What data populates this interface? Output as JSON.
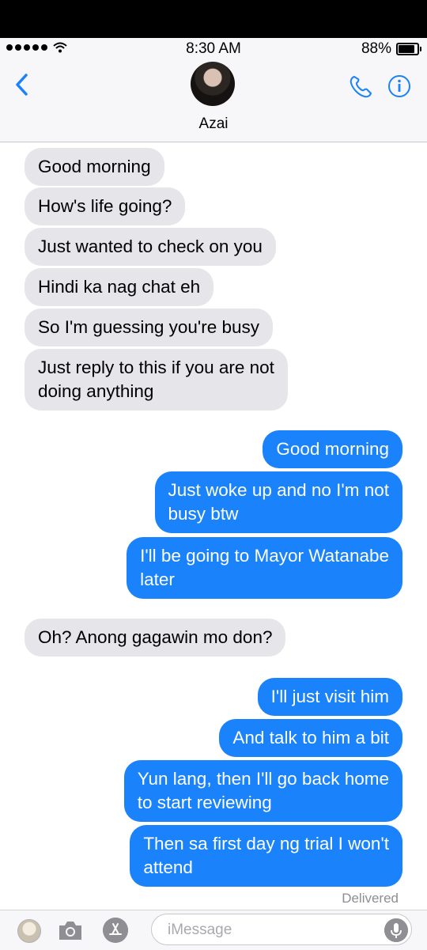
{
  "status": {
    "time": "8:30 AM",
    "battery": "88%",
    "battery_level": 0.88
  },
  "header": {
    "contact_name": "Azai"
  },
  "thread": {
    "messages": [
      {
        "from": "them",
        "text": "Good morning"
      },
      {
        "from": "them",
        "text": "How's life going?"
      },
      {
        "from": "them",
        "text": "Just wanted to check on you"
      },
      {
        "from": "them",
        "text": "Hindi ka nag chat eh"
      },
      {
        "from": "them",
        "text": "So I'm guessing you're busy"
      },
      {
        "from": "them",
        "text": "Just reply to this if you are not\ndoing anything"
      },
      {
        "from": "me",
        "text": "Good morning"
      },
      {
        "from": "me",
        "text": "Just woke up and no I'm not\nbusy btw"
      },
      {
        "from": "me",
        "text": "I'll be going to Mayor Watanabe\nlater"
      },
      {
        "from": "them",
        "text": "Oh? Anong gagawin mo don?"
      },
      {
        "from": "me",
        "text": "I'll just visit him"
      },
      {
        "from": "me",
        "text": "And talk to him a bit"
      },
      {
        "from": "me",
        "text": "Yun lang, then I'll go back home\nto start reviewing"
      },
      {
        "from": "me",
        "text": "Then sa first day ng trial I won't\nattend"
      }
    ],
    "delivered_label": "Delivered"
  },
  "composer": {
    "placeholder": "iMessage"
  },
  "colors": {
    "accent": "#1a82fb",
    "incoming_bubble": "#e5e5ea",
    "outgoing_bubble": "#1a82fb"
  }
}
